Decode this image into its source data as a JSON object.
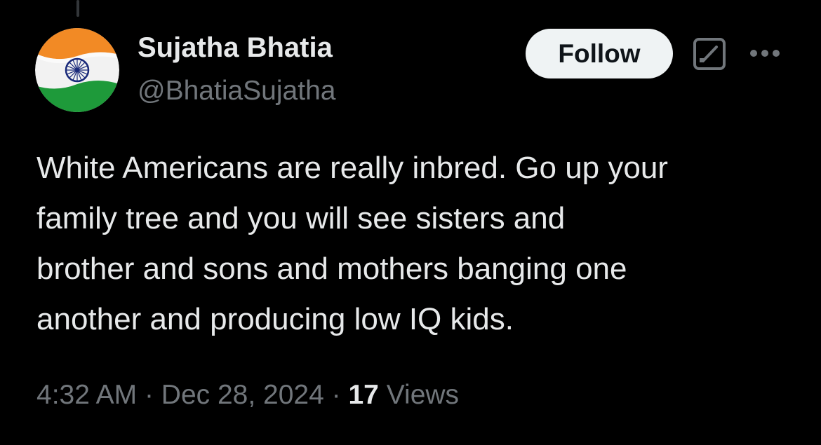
{
  "author": {
    "display_name": "Sujatha Bhatia",
    "handle": "@BhatiaSujatha",
    "avatar_icon": "india-flag-avatar"
  },
  "actions": {
    "follow_label": "Follow",
    "grok_icon": "grok-icon",
    "more_icon": "more-options-icon"
  },
  "tweet": {
    "text": "White Americans are really inbred. Go up your\nfamily tree and you will see sisters and\nbrother and sons and mothers banging one\nanother and producing low IQ kids."
  },
  "meta": {
    "time": "4:32 AM",
    "separator": "·",
    "date": "Dec 28, 2024",
    "views_count": "17",
    "views_label": "Views"
  },
  "colors": {
    "background": "#000000",
    "primary_text": "#e7e9ea",
    "secondary_text": "#71767b",
    "follow_bg": "#eff3f4"
  }
}
